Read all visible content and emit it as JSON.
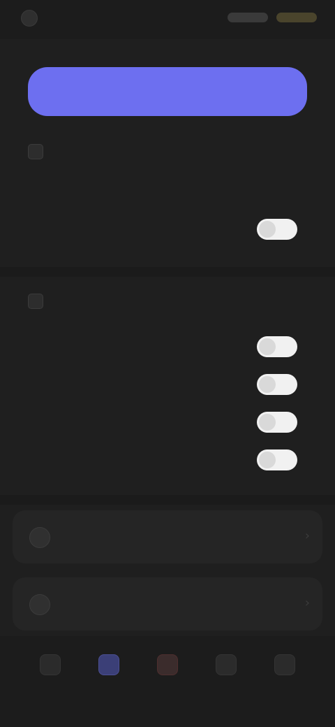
{
  "header": {
    "brand_name": "",
    "pill_left": "",
    "pill_right": ""
  },
  "cta": {
    "label": ""
  },
  "section1": {
    "title": "",
    "rows": [
      {
        "label": "",
        "value": ""
      },
      {
        "label": "",
        "toggle": true
      }
    ]
  },
  "section2": {
    "title": "",
    "rows": [
      {
        "label": "",
        "toggle": true
      },
      {
        "label": "",
        "toggle": true
      },
      {
        "label": "",
        "toggle": true
      },
      {
        "label": "",
        "toggle": true
      }
    ]
  },
  "panels": [
    {
      "label": ""
    },
    {
      "label": ""
    }
  ],
  "bottom_nav": {
    "items": [
      {
        "label": ""
      },
      {
        "label": ""
      },
      {
        "label": ""
      },
      {
        "label": ""
      },
      {
        "label": ""
      }
    ]
  },
  "colors": {
    "accent": "#6d6ff0",
    "background": "#1f1f1f",
    "toggle_on": "#f1f1f1"
  }
}
